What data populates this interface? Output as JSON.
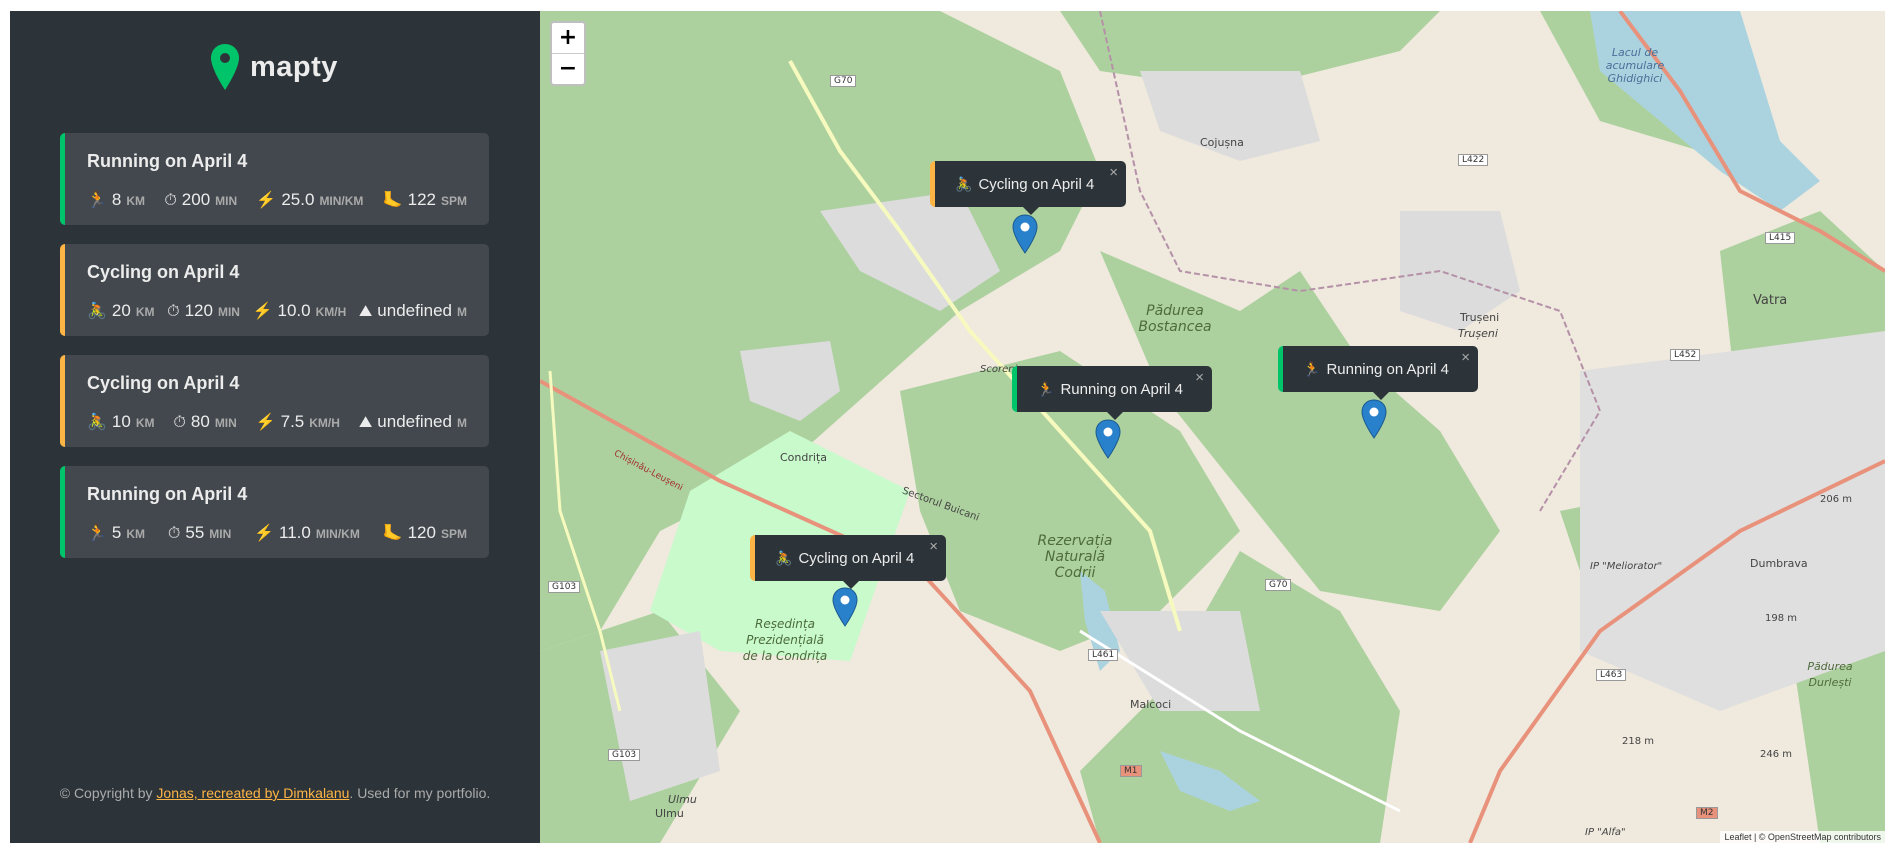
{
  "app": {
    "logo_text": "mapty",
    "brand_green": "#00c46a",
    "brand_yellow": "#ffb545"
  },
  "workouts": [
    {
      "type": "running",
      "title": "Running on April 4",
      "details": [
        {
          "icon": "🏃",
          "value": "8",
          "unit": "KM"
        },
        {
          "icon": "⏱",
          "value": "200",
          "unit": "MIN"
        },
        {
          "icon": "⚡",
          "value": "25.0",
          "unit": "MIN/KM"
        },
        {
          "icon": "🦶",
          "value": "122",
          "unit": "SPM"
        }
      ]
    },
    {
      "type": "cycling",
      "title": "Cycling on April 4",
      "details": [
        {
          "icon": "🚴",
          "value": "20",
          "unit": "KM"
        },
        {
          "icon": "⏱",
          "value": "120",
          "unit": "MIN"
        },
        {
          "icon": "⚡",
          "value": "10.0",
          "unit": "KM/H"
        },
        {
          "icon": "⛰",
          "value": "undefined",
          "unit": "M"
        }
      ]
    },
    {
      "type": "cycling",
      "title": "Cycling on April 4",
      "details": [
        {
          "icon": "🚴",
          "value": "10",
          "unit": "KM"
        },
        {
          "icon": "⏱",
          "value": "80",
          "unit": "MIN"
        },
        {
          "icon": "⚡",
          "value": "7.5",
          "unit": "KM/H"
        },
        {
          "icon": "⛰",
          "value": "undefined",
          "unit": "M"
        }
      ]
    },
    {
      "type": "running",
      "title": "Running on April 4",
      "details": [
        {
          "icon": "🏃",
          "value": "5",
          "unit": "KM"
        },
        {
          "icon": "⏱",
          "value": "55",
          "unit": "MIN"
        },
        {
          "icon": "⚡",
          "value": "11.0",
          "unit": "MIN/KM"
        },
        {
          "icon": "🦶",
          "value": "120",
          "unit": "SPM"
        }
      ]
    }
  ],
  "copyright": {
    "prefix": "© Copyright by ",
    "link": "Jonas, recreated by Dimkalanu",
    "suffix": ". Used for my portfolio."
  },
  "map": {
    "zoom_in": "+",
    "zoom_out": "−",
    "popups": [
      {
        "type": "cycling",
        "icon": "🚴",
        "text": "Cycling on April 4",
        "close": "×"
      },
      {
        "type": "running",
        "icon": "🏃",
        "text": "Running on April 4",
        "close": "×"
      },
      {
        "type": "running",
        "icon": "🏃",
        "text": "Running on April 4",
        "close": "×"
      },
      {
        "type": "cycling",
        "icon": "🚴",
        "text": "Cycling on April 4",
        "close": "×"
      }
    ],
    "place_labels": {
      "cojusna": "Cojușna",
      "condrita": "Condrița",
      "trușeni": "Trușeni",
      "truseni_it": "Trușeni",
      "vatra": "Vatra",
      "dumbrava": "Dumbrava",
      "malcoci": "Malcoci",
      "ulmu": "Ulmu",
      "ulmu2": "Ulmu",
      "scoreni": "Scoreni",
      "padurea_bostancea": "Pădurea Bostancea",
      "rezervatia": "Rezervația Naturală Codrii",
      "resedinta": "Reședința Prezidențială de la Condrița",
      "lacul": "Lacul de acumulare Ghidighici",
      "padurea_durlesti": "Pădurea Durlești",
      "ip_meliorator": "IP \"Meliorator\"",
      "ip_alfa": "IP \"Alfa\"",
      "h206": "206 m",
      "h198": "198 m",
      "h218": "218 m",
      "h246": "246 m",
      "sectorul_buicani": "Sectorul Buicani",
      "chisinau_leuseni": "Chișinău-Leușeni"
    },
    "road_signs": {
      "g70a": "G70",
      "g70b": "G70",
      "l422": "L422",
      "l415": "L415",
      "l452": "L452",
      "l461": "L461",
      "l463": "L463",
      "g103a": "G103",
      "g103b": "G103",
      "m1": "M1",
      "m2": "M2"
    },
    "attribution": "Leaflet | © OpenStreetMap contributors"
  }
}
